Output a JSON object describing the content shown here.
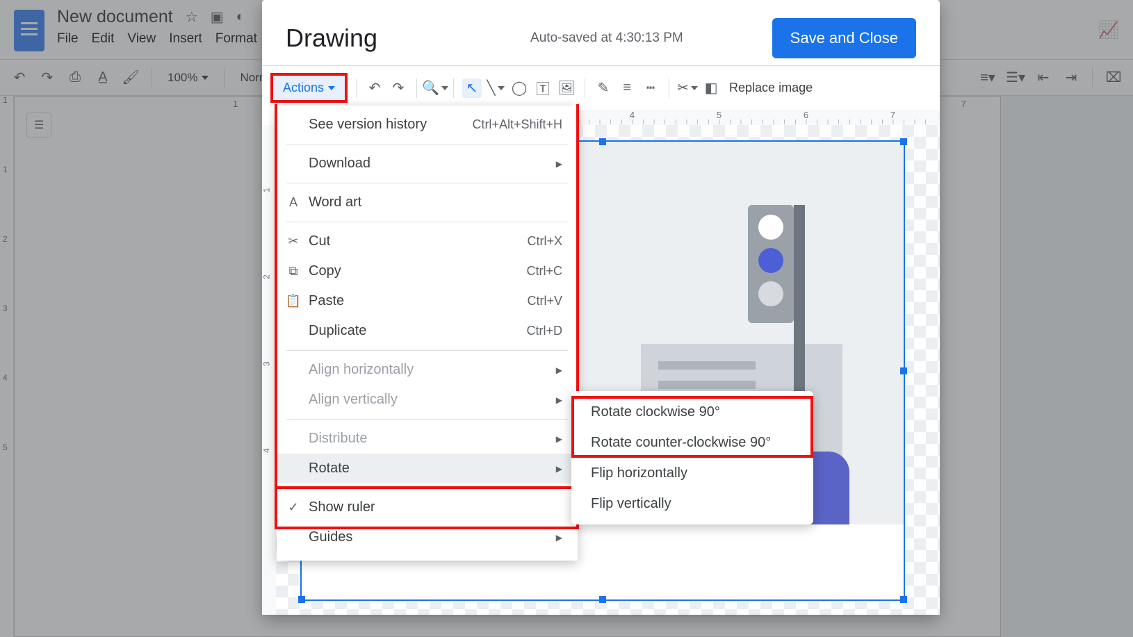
{
  "docs": {
    "title": "New document",
    "menus": [
      "File",
      "Edit",
      "View",
      "Insert",
      "Format"
    ],
    "zoom": "100%",
    "style": "Norm",
    "ruler_numbers": [
      "1",
      "1",
      "2",
      "3",
      "4",
      "5"
    ],
    "top_ruler_right": "7"
  },
  "drawing": {
    "title": "Drawing",
    "status": "Auto-saved at 4:30:13 PM",
    "save_label": "Save and Close",
    "actions_label": "Actions",
    "replace_label": "Replace image",
    "hruler": [
      "4",
      "5",
      "6",
      "7"
    ],
    "vruler": [
      "1",
      "2",
      "3",
      "4"
    ]
  },
  "menu": {
    "see_version": "See version history",
    "see_version_kb": "Ctrl+Alt+Shift+H",
    "download": "Download",
    "word_art": "Word art",
    "cut": "Cut",
    "cut_kb": "Ctrl+X",
    "copy": "Copy",
    "copy_kb": "Ctrl+C",
    "paste": "Paste",
    "paste_kb": "Ctrl+V",
    "duplicate": "Duplicate",
    "dup_kb": "Ctrl+D",
    "align_h": "Align horizontally",
    "align_v": "Align vertically",
    "distribute": "Distribute",
    "rotate": "Rotate",
    "show_ruler": "Show ruler",
    "guides": "Guides"
  },
  "submenu": {
    "rot_cw": "Rotate clockwise 90°",
    "rot_ccw": "Rotate counter-clockwise 90°",
    "flip_h": "Flip horizontally",
    "flip_v": "Flip vertically"
  }
}
